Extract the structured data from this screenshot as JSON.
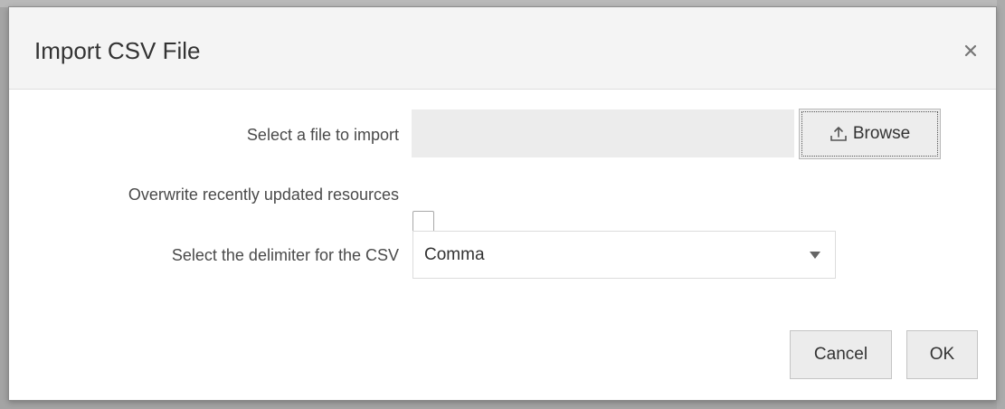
{
  "dialog": {
    "title": "Import CSV File",
    "close_icon": "close-icon"
  },
  "form": {
    "file": {
      "label": "Select a file to import",
      "value": "",
      "browse_label": "Browse",
      "browse_icon": "upload-icon"
    },
    "overwrite": {
      "label": "Overwrite recently updated resources",
      "checked": false
    },
    "delimiter": {
      "label": "Select the delimiter for the CSV",
      "selected": "Comma"
    }
  },
  "footer": {
    "cancel_label": "Cancel",
    "ok_label": "OK"
  },
  "colors": {
    "header_bg": "#f4f4f4",
    "field_bg": "#ececec",
    "text": "#333333"
  }
}
